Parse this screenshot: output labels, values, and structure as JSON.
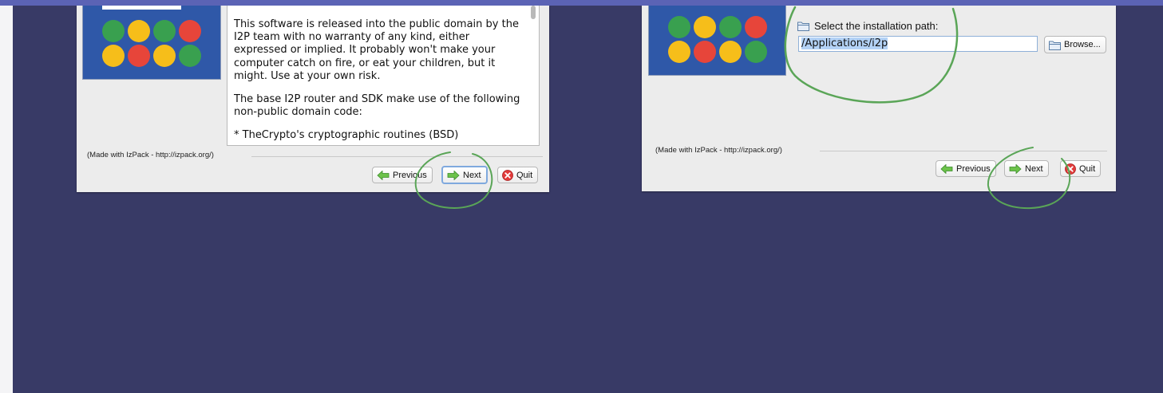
{
  "colors": {
    "background": "#383a66",
    "accent_bar": "#5b63b5",
    "logo_blue": "#2f58a8",
    "green": "#39a04f",
    "yellow": "#f6be1a",
    "red": "#e7453a",
    "annotation_green": "#5aa557"
  },
  "left_window": {
    "logo_dots": [
      "green",
      "yellow",
      "green",
      "red",
      "yellow",
      "red",
      "yellow",
      "green"
    ],
    "license_paragraphs": [
      "This software is released into the public domain by the I2P team with no warranty of any kind, either expressed or implied. It probably won't make your computer catch on fire, or eat your children, but it might. Use at your own risk.",
      "The base I2P router and SDK make use of the following non-public domain code:",
      "* TheCrypto's cryptographic routines (BSD)"
    ],
    "made_with": "(Made with IzPack - http://izpack.org/)",
    "buttons": {
      "previous": "Previous",
      "next": "Next",
      "quit": "Quit"
    }
  },
  "right_window": {
    "logo_dots": [
      "green",
      "yellow",
      "green",
      "red",
      "yellow",
      "red",
      "yellow",
      "green"
    ],
    "path_label": "Select the installation path:",
    "path_value": "/Applications/i2p",
    "browse_label": "Browse...",
    "made_with": "(Made with IzPack - http://izpack.org/)",
    "buttons": {
      "previous": "Previous",
      "next": "Next",
      "quit": "Quit"
    }
  },
  "icons": {
    "previous": "arrow-left-icon",
    "next": "arrow-right-icon",
    "quit": "close-circle-icon",
    "folder": "folder-icon"
  }
}
